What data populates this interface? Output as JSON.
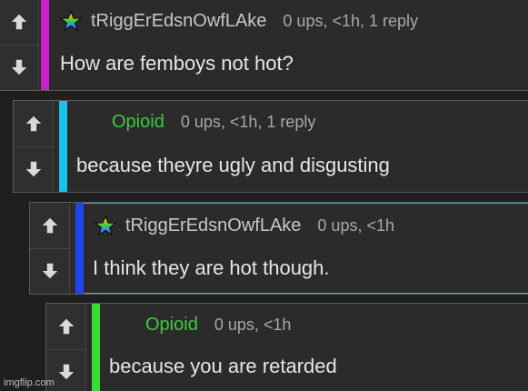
{
  "colors": {
    "magenta": "#cc22cc",
    "cyan": "#19c3e8",
    "blue": "#2244ee",
    "green": "#33dd33",
    "username_green": "#3ecb3e"
  },
  "icons": {
    "upvote": "up-arrow-icon",
    "downvote": "down-arrow-icon",
    "badge": "rainbow-star-icon"
  },
  "comments": [
    {
      "username": "tRiggErEdsnOwfLAke",
      "stats": "0 ups, <1h, 1 reply",
      "text": "How are femboys not hot?"
    },
    {
      "username": "Opioid",
      "stats": "0 ups, <1h, 1 reply",
      "text": "because theyre ugly and disgusting"
    },
    {
      "username": "tRiggErEdsnOwfLAke",
      "stats": "0 ups, <1h",
      "text": "I think they are hot though."
    },
    {
      "username": "Opioid",
      "stats": "0 ups, <1h",
      "text": "because you are retarded"
    }
  ],
  "watermark": "imgflip.com"
}
